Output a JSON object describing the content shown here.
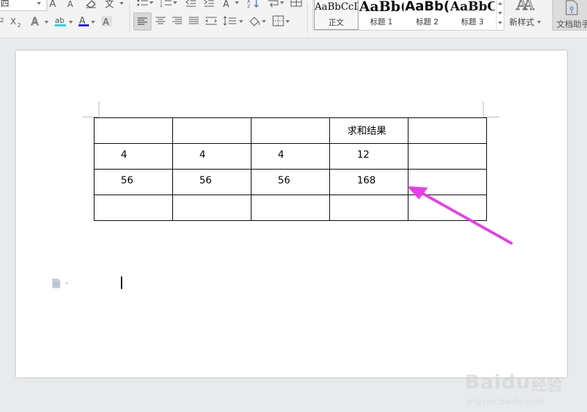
{
  "ribbon": {
    "font_size_value": "四",
    "styles": [
      {
        "preview": "AaBbCcD",
        "name": "正文",
        "selected": true
      },
      {
        "preview": "AaBb(",
        "name": "标题 1"
      },
      {
        "preview": "AaBb(",
        "name": "标题 2"
      },
      {
        "preview": "AaBbC",
        "name": "标题 3"
      }
    ],
    "new_style_label": "新样式",
    "doc_helper_label": "文档助手"
  },
  "table": {
    "rows": [
      [
        "",
        "",
        "",
        "求和结果",
        ""
      ],
      [
        "4",
        "4",
        "4",
        "12",
        ""
      ],
      [
        "56",
        "56",
        "56",
        "168",
        ""
      ],
      [
        "",
        "",
        "",
        "",
        ""
      ]
    ]
  },
  "annotation": {
    "arrow_color": "#e83ee8"
  },
  "watermark": {
    "brand": "Baidu",
    "brand_cn": "经验",
    "url": "jingyan.baidu.com"
  }
}
